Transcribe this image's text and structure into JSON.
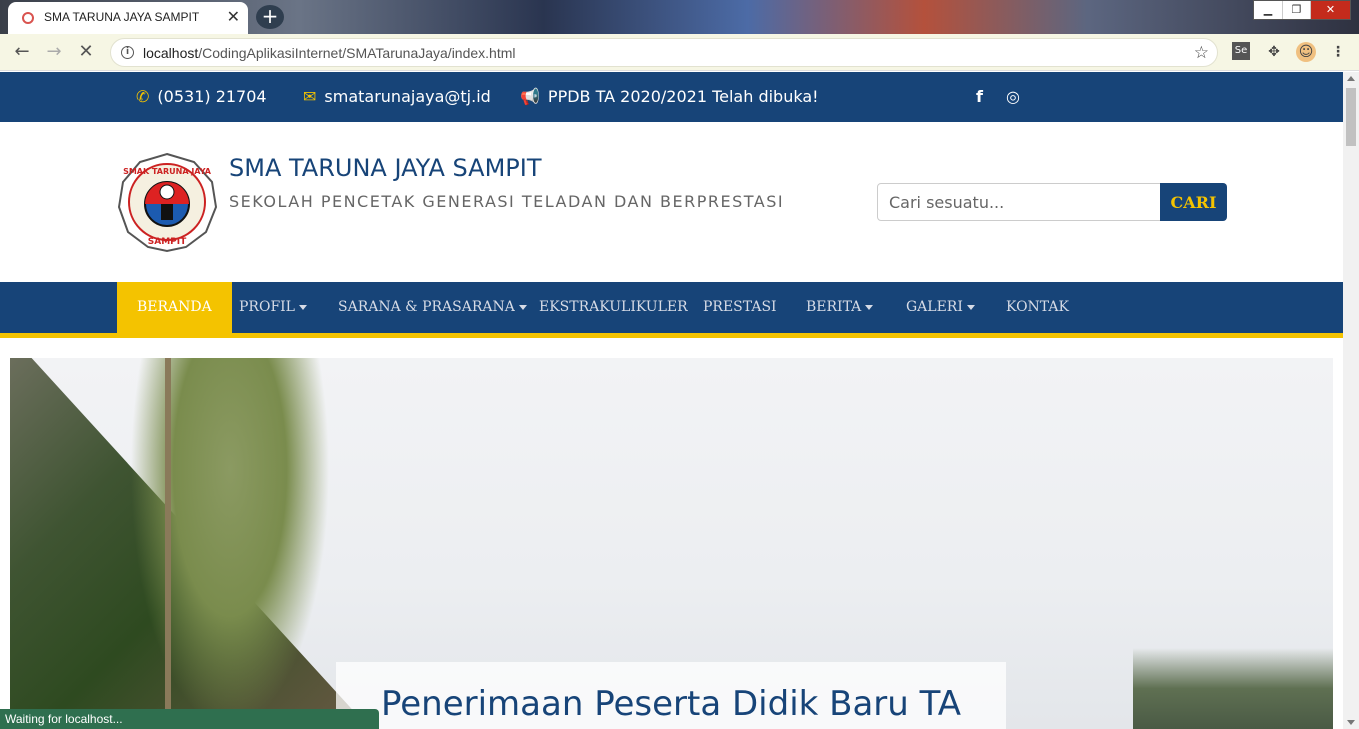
{
  "browser": {
    "tab_title": "SMA TARUNA JAYA SAMPIT",
    "url_host": "localhost",
    "url_path": "/CodingAplikasiInternet/SMATarunaJaya/index.html",
    "status_text": "Waiting for localhost..."
  },
  "topbar": {
    "phone": "(0531) 21704",
    "email": "smatarunajaya@tj.id",
    "announcement": "PPDB TA 2020/2021 Telah dibuka!",
    "social_facebook": "f",
    "social_instagram": "◎"
  },
  "header": {
    "title": "SMA TARUNA JAYA SAMPIT",
    "tagline": "SEKOLAH PENCETAK GENERASI TELADAN DAN BERPRESTASI",
    "logo_text": "SMAK TARUNA JAYA SAMPIT",
    "search_placeholder": "Cari sesuatu...",
    "search_button": "CARI"
  },
  "nav": {
    "items": [
      {
        "label": "BERANDA",
        "active": true
      },
      {
        "label": "PROFIL"
      },
      {
        "label": "SARANA & PRASARANA"
      },
      {
        "label": "EKSTRAKULIKULER"
      },
      {
        "label": "PRESTASI"
      },
      {
        "label": "BERITA"
      },
      {
        "label": "GALERI"
      },
      {
        "label": "KONTAK"
      }
    ]
  },
  "hero": {
    "caption": "Penerimaan Peserta Didik Baru TA"
  },
  "colors": {
    "primary": "#174478",
    "accent": "#f4c300"
  }
}
